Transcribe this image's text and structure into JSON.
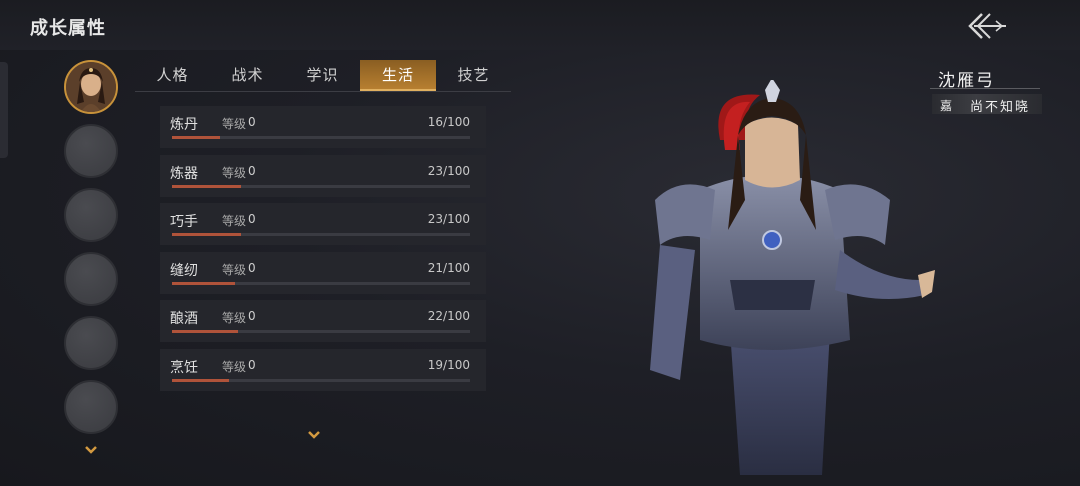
{
  "header": {
    "title": "成长属性",
    "back_icon": "back-arrow-icon"
  },
  "slots": {
    "count": 6,
    "active_index": 0
  },
  "tabs": [
    {
      "label": "人格",
      "active": false
    },
    {
      "label": "战术",
      "active": false
    },
    {
      "label": "学识",
      "active": false
    },
    {
      "label": "生活",
      "active": true
    },
    {
      "label": "技艺",
      "active": false
    }
  ],
  "skills": [
    {
      "name": "炼丹",
      "level_label": "等级",
      "level": "0",
      "progress": "16/100",
      "fraction": 0.16
    },
    {
      "name": "炼器",
      "level_label": "等级",
      "level": "0",
      "progress": "23/100",
      "fraction": 0.23
    },
    {
      "name": "巧手",
      "level_label": "等级",
      "level": "0",
      "progress": "23/100",
      "fraction": 0.23
    },
    {
      "name": "缝纫",
      "level_label": "等级",
      "level": "0",
      "progress": "21/100",
      "fraction": 0.21
    },
    {
      "name": "酿酒",
      "level_label": "等级",
      "level": "0",
      "progress": "22/100",
      "fraction": 0.22
    },
    {
      "name": "烹饪",
      "level_label": "等级",
      "level": "0",
      "progress": "19/100",
      "fraction": 0.19
    }
  ],
  "character": {
    "name": "沈雁弓",
    "title": "尚不知晓",
    "title_icon": "嘉"
  },
  "colors": {
    "accent": "#c8923a",
    "progress_fill": "#b0533a",
    "tab_active": "#b77f30"
  }
}
